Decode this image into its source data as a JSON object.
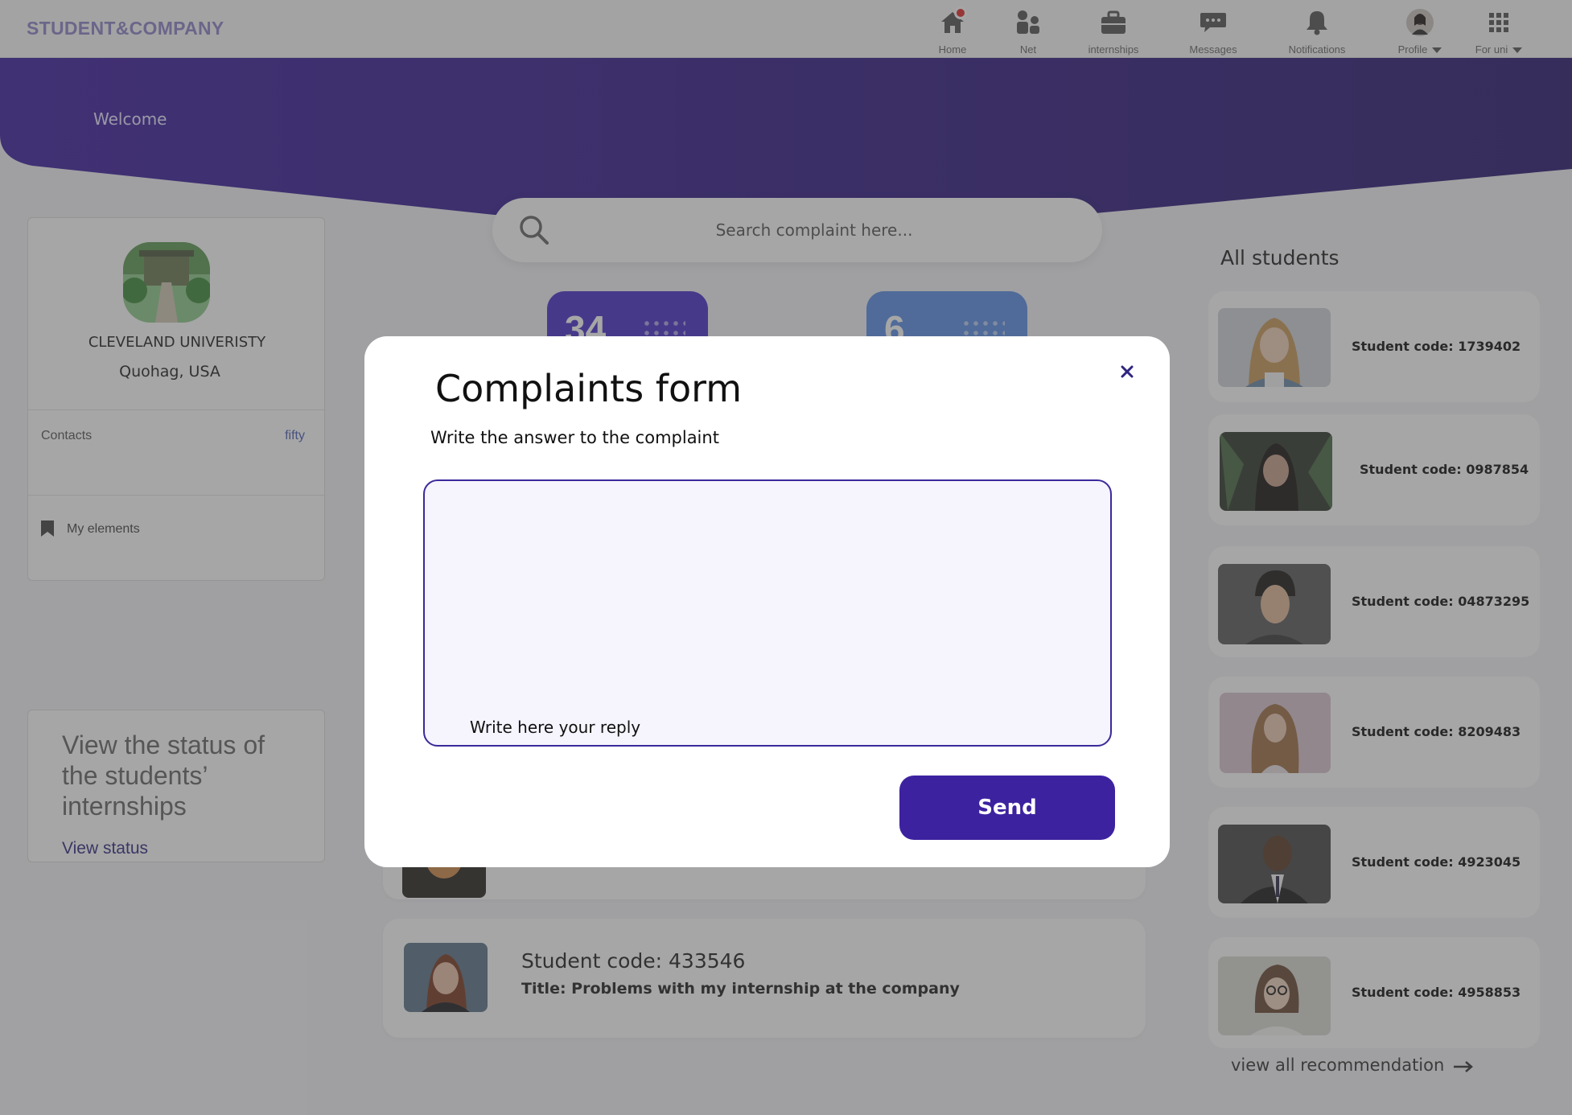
{
  "app": {
    "brand": "STUDENT&COMPANY"
  },
  "nav": {
    "items": [
      {
        "label": "Home",
        "icon": "home-icon",
        "has_badge": true
      },
      {
        "label": "Net",
        "icon": "people-icon"
      },
      {
        "label": "internships",
        "icon": "briefcase-icon"
      },
      {
        "label": "Messages",
        "icon": "chat-icon"
      },
      {
        "label": "Notifications",
        "icon": "bell-icon"
      },
      {
        "label": "Profile",
        "icon": "avatar"
      },
      {
        "label": "For uni",
        "icon": "grid-icon"
      }
    ]
  },
  "hero": {
    "welcome": "Welcome"
  },
  "search": {
    "placeholder": "Search complaint here..."
  },
  "stats": [
    {
      "value": "34"
    },
    {
      "value": "6"
    }
  ],
  "profile": {
    "name": "CLEVELAND UNIVERISTY",
    "location": "Quohag, USA",
    "contacts_label": "Contacts",
    "contacts_value": "fifty",
    "elements_label": "My elements"
  },
  "status_panel": {
    "text": "View the status of the students’ internships",
    "link": "View status"
  },
  "complaints": [
    {
      "code": "Student code: 433546",
      "title": "Title: Problems with my internship at the company"
    }
  ],
  "students": {
    "heading": "All students",
    "items": [
      {
        "code": "Student code: 1739402"
      },
      {
        "code": "Student code: 0987854"
      },
      {
        "code": "Student code: 04873295"
      },
      {
        "code": "Student code: 8209483"
      },
      {
        "code": "Student code: 4923045"
      },
      {
        "code": "Student code: 4958853"
      }
    ],
    "view_all": "view all recommendation"
  },
  "modal": {
    "title": "Complaints form",
    "subtitle": "Write the answer to the complaint",
    "reply_placeholder": "Write here your reply",
    "send_label": "Send"
  },
  "colors": {
    "hero_start": "#3d1fa0",
    "hero_end": "#2a1870",
    "primary_button": "#3d22a0",
    "stat_card_1": "#4a2ec9",
    "stat_card_2": "#5a8ee6",
    "badge": "#e22a2a"
  }
}
